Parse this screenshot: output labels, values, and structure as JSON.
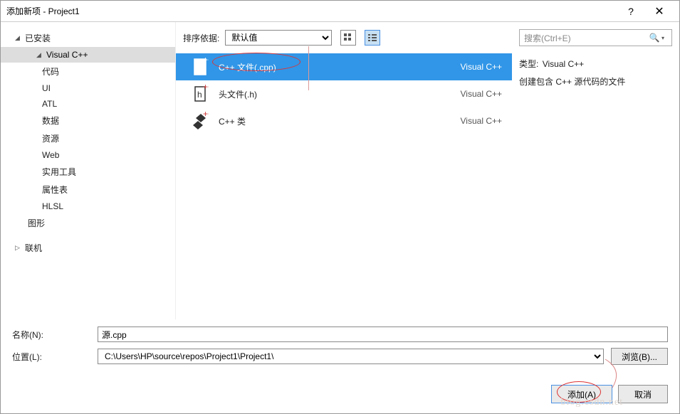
{
  "title": "添加新项 - Project1",
  "sidebar": {
    "installed": "已安装",
    "visual_cpp": "Visual C++",
    "items": [
      "代码",
      "UI",
      "ATL",
      "数据",
      "资源",
      "Web",
      "实用工具",
      "属性表",
      "HLSL"
    ],
    "graphics": "图形",
    "online": "联机"
  },
  "toolbar": {
    "sort_label": "排序依据:",
    "sort_value": "默认值"
  },
  "templates": [
    {
      "name": "C++ 文件(.cpp)",
      "lang": "Visual C++",
      "selected": true
    },
    {
      "name": "头文件(.h)",
      "lang": "Visual C++",
      "selected": false
    },
    {
      "name": "C++ 类",
      "lang": "Visual C++",
      "selected": false
    }
  ],
  "right": {
    "search_placeholder": "搜索(Ctrl+E)",
    "type_label": "类型:",
    "type_value": "Visual C++",
    "desc": "创建包含 C++ 源代码的文件"
  },
  "fields": {
    "name_label": "名称(N):",
    "name_value": "源.cpp",
    "location_label": "位置(L):",
    "location_value": "C:\\Users\\HP\\source\\repos\\Project1\\Project1\\",
    "browse": "浏览(B)..."
  },
  "buttons": {
    "add": "添加(A)",
    "cancel": "取消"
  },
  "watermark": "blog.csdn.net"
}
